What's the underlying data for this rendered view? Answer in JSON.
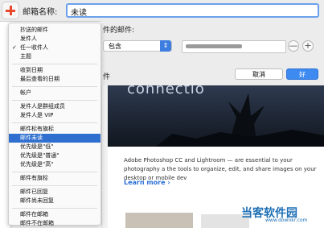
{
  "dialog": {
    "mailbox_name_label": "邮箱名称:",
    "mailbox_name_value": "未读",
    "rule_label_partial": "件的邮件:",
    "operator_value": "包含",
    "partial_label_2": "件",
    "cancel_label": "取消",
    "ok_label": "好",
    "remove_symbol": "—",
    "add_symbol": "+"
  },
  "menu": {
    "selected_index": 13,
    "checked_index": 2,
    "items": [
      "抄送的邮件",
      "发件人",
      "任一收件人",
      "主题",
      "收到日期",
      "最后查看的日期",
      "帐户",
      "发件人是群组成员",
      "发件人是 VIP",
      "邮件标有旗标",
      "邮件未读",
      "优先级是\"低\"",
      "优先级是\"普通\"",
      "优先级是\"高\"",
      "邮件有旗标",
      "邮件已回复",
      "邮件尚未回复",
      "邮件在邮箱",
      "邮件不在邮箱"
    ],
    "check_mark": "✓"
  },
  "preview": {
    "hero_title": "connectio",
    "article_text": "Adobe Photoshop CC and Lightroom — are essential to your photography a the tools to organize, edit, and share images on your desktop or mobile dev",
    "learn_more": "Learn more ›"
  },
  "watermark": {
    "brand": "当客软件园",
    "url": "www.downkr.com"
  }
}
